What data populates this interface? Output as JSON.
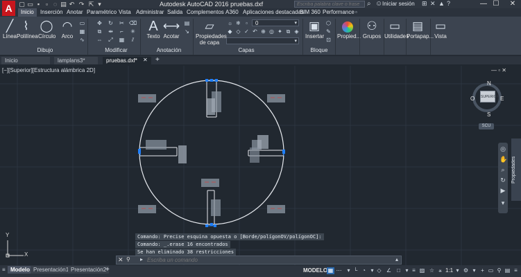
{
  "title_bar": {
    "title": "Autodesk AutoCAD 2016    pruebas.dxf",
    "search_placeholder": "Escriba palabra clave o frase",
    "signin": "Iniciar sesión",
    "minimize": "—",
    "maximize": "☐",
    "close": "✕"
  },
  "ribbon_tabs": [
    "Inicio",
    "Inserción",
    "Anotar",
    "Paramétrico",
    "Vista",
    "Administrar",
    "Salida",
    "Complementos",
    "A360",
    "Aplicaciones destacadas",
    "BIM 360",
    "Performance"
  ],
  "ribbon": {
    "linea": "Línea",
    "polilinea": "Polilínea",
    "circulo": "Círculo",
    "arco": "Arco",
    "texto": "Texto",
    "acotar": "Acotar",
    "propiedades_capa": "Propiedades de capa",
    "layer_value": "0",
    "insertar": "Insertar",
    "propiedades": "Propied...",
    "grupos": "Grupos",
    "utilidades": "Utilidades",
    "portapapeles": "Portapap...",
    "vista": "Vista",
    "groups": {
      "dibujo": "Dibujo",
      "modificar": "Modificar",
      "anotacion": "Anotación",
      "capas": "Capas",
      "bloque": "Bloque"
    }
  },
  "doc_tabs": [
    "Inicio",
    "lamplans3*",
    "pruebas.dxf*"
  ],
  "viewport": {
    "label": "[−][Superior][Estructura alámbrica 2D]",
    "controls": "— ▫ ✕"
  },
  "viewcube": {
    "n": "N",
    "s": "S",
    "e": "E",
    "o": "O",
    "face": "SUPERIOR",
    "ucs": "SCU"
  },
  "properties_palette": "Propiedades",
  "command_history": [
    "Comando: Precise esquina opuesta o [Borde/polígonOV/polígonOC]:",
    "Comando:  _.erase 16 encontrados",
    "Se han eliminado 38 restricciones"
  ],
  "command_input_placeholder": "Escriba un comando",
  "ucs": {
    "y": "Y",
    "x": "X"
  },
  "layout_tabs": [
    "Modelo",
    "Presentación1",
    "Presentación2"
  ],
  "add_layout": "+",
  "status": {
    "model": "MODELO",
    "scale": "1:1"
  },
  "colors": {
    "canvas": "#212830",
    "accent": "#2c6bb0",
    "grip": "#1e7fff",
    "logo": "#c8161d"
  }
}
